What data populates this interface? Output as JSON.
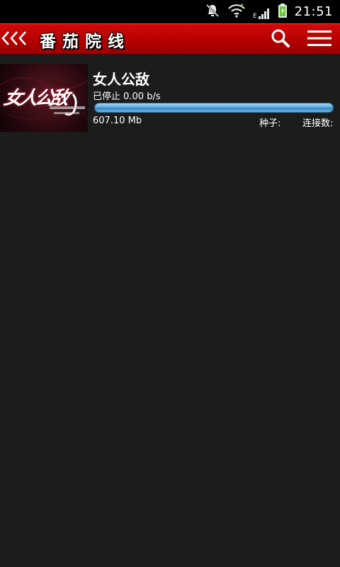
{
  "status_bar": {
    "time": "21:51",
    "network_type": "E",
    "icons": [
      "notifications-muted-icon",
      "wifi-icon",
      "cell-signal-icon",
      "battery-charging-icon"
    ]
  },
  "app_bar": {
    "back_icon": "back-chevrons-icon",
    "title": "番茄院线",
    "search_icon": "search-icon",
    "menu_icon": "menu-icon",
    "background_color": "#b80000"
  },
  "downloads": [
    {
      "title": "女人公敌",
      "status": "已停止 0.00 b/s",
      "progress": 1.0,
      "size": "607.10 Mb",
      "seeds_label": "种子:",
      "peers_label": "连接数:",
      "poster_text": "女人公敌"
    }
  ],
  "colors": {
    "progress": "#4aa0d8",
    "background": "#1c1c1c"
  }
}
